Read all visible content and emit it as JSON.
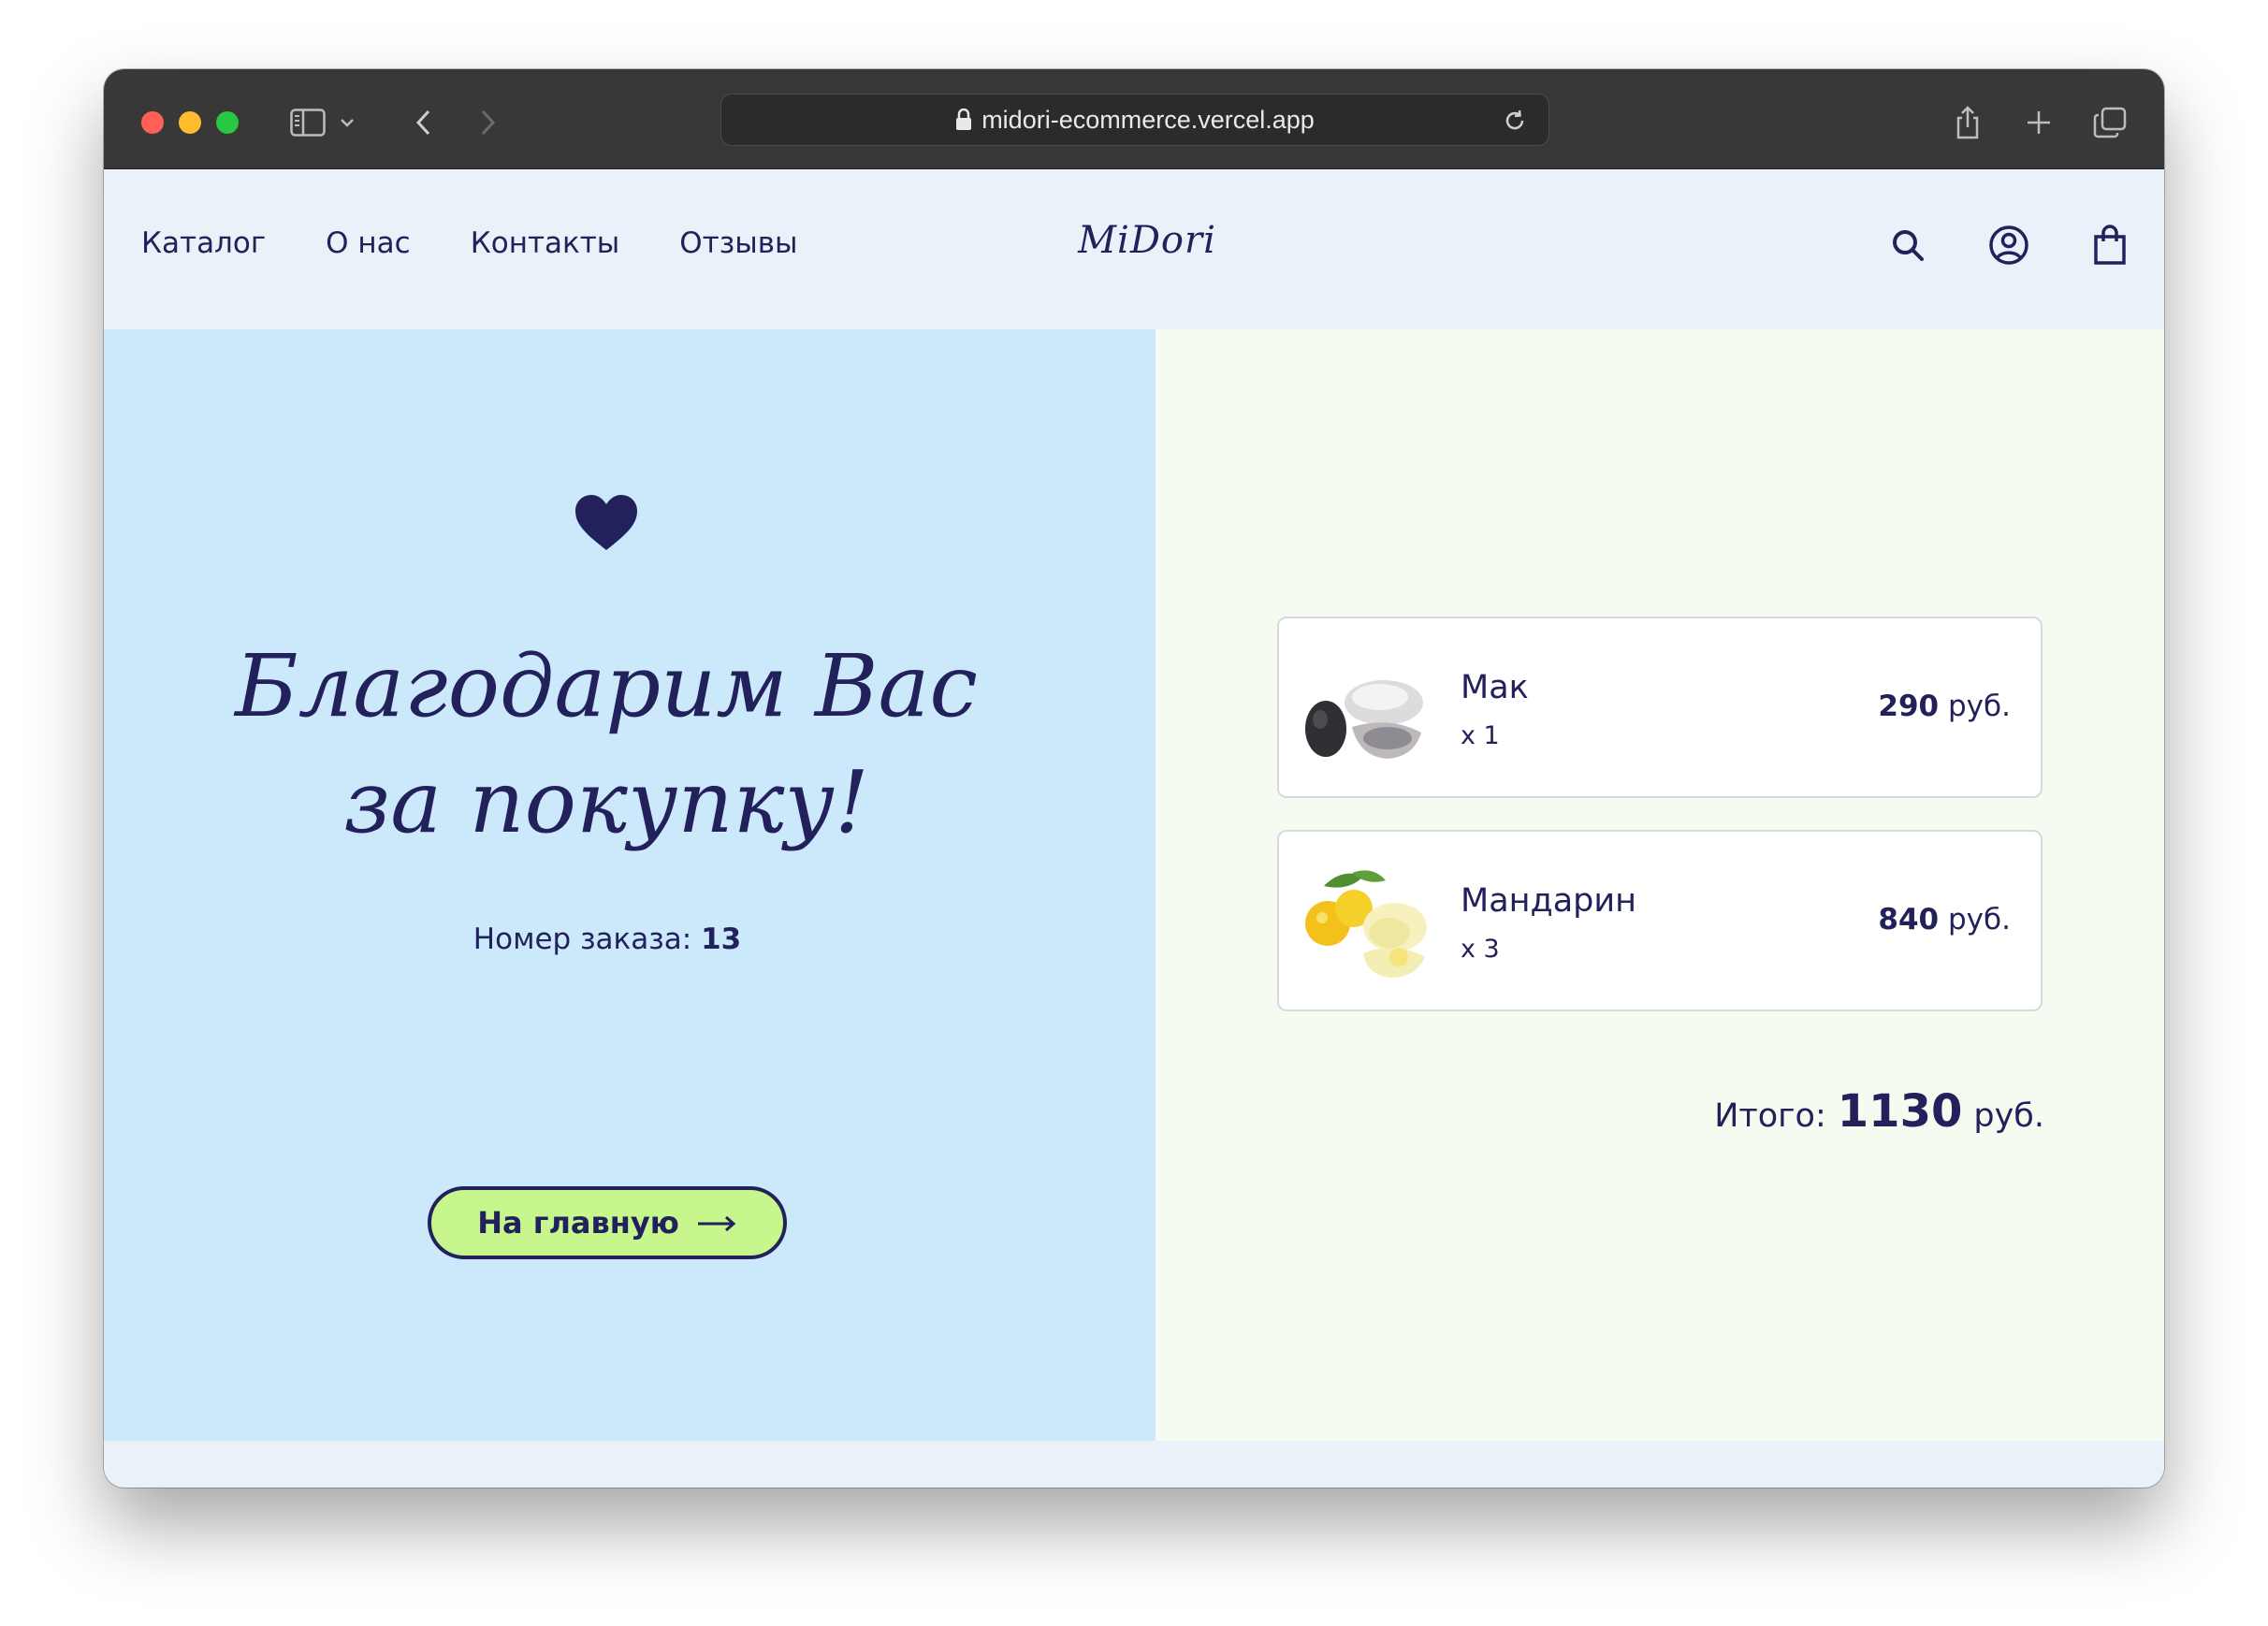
{
  "browser": {
    "url": "midori-ecommerce.vercel.app"
  },
  "header": {
    "nav": [
      "Каталог",
      "О нас",
      "Контакты",
      "Отзывы"
    ],
    "logo": "MiDori",
    "icons": [
      "search-icon",
      "user-circle-icon",
      "shopping-bag-icon"
    ]
  },
  "thanks": {
    "line1": "Благодарим Вас",
    "line2": "за покупку!",
    "order_label": "Номер заказа:",
    "order_number": "13",
    "home_button": "На главную"
  },
  "cart": {
    "items": [
      {
        "name": "Мак",
        "qty": "x 1",
        "price": "290",
        "currency": "руб."
      },
      {
        "name": "Мандарин",
        "qty": "x 3",
        "price": "840",
        "currency": "руб."
      }
    ],
    "total_label": "Итого:",
    "total_value": "1130",
    "total_currency": "руб."
  },
  "colors": {
    "navy": "#22215b",
    "left_bg": "#cbe9fa",
    "right_bg": "#f6fbf1",
    "button_bg": "#c6f68c"
  }
}
